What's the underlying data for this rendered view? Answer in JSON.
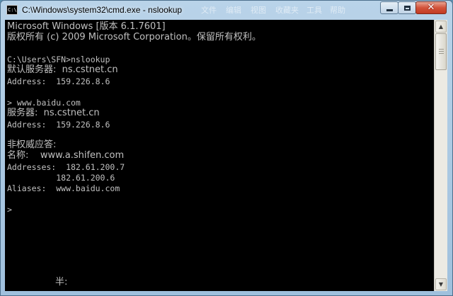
{
  "window": {
    "title": "C:\\Windows\\system32\\cmd.exe - nslookup",
    "icon_label": "C:\\",
    "ghost_menu": [
      "文件",
      "编辑",
      "视图",
      "收藏夹",
      "工具",
      "帮助"
    ]
  },
  "controls": {
    "minimize_icon": "minimize-icon",
    "maximize_icon": "maximize-icon",
    "close_glyph": "✕"
  },
  "console": {
    "lines": [
      "Microsoft Windows [版本 6.1.7601]",
      "版权所有 (c) 2009 Microsoft Corporation。保留所有权利。",
      "C:\\Users\\SFN>nslookup",
      "默认服务器:  ns.cstnet.cn",
      "Address:  159.226.8.6",
      "> www.baidu.com",
      "服务器:  ns.cstnet.cn",
      "Address:  159.226.8.6",
      "非权威应答:",
      "名称:    www.a.shifen.com",
      "Addresses:  182.61.200.7",
      "          182.61.200.6",
      "Aliases:  www.baidu.com",
      ">",
      "半:"
    ]
  },
  "scrollbar": {
    "up_glyph": "▲",
    "down_glyph": "▼"
  }
}
